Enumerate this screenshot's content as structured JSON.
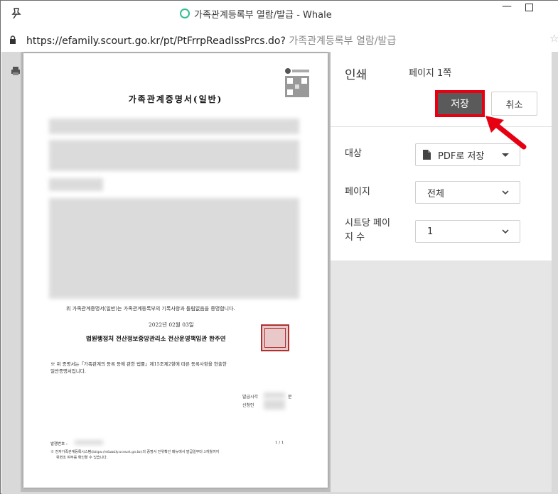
{
  "window": {
    "title": "가족관계등록부 열람/발급 - Whale",
    "minimize_glyph": "—"
  },
  "address": {
    "url": "https://efamily.scourt.go.kr/pt/PtFrrpReadIssPrcs.do?",
    "page_name": "가족관계등록부 열람/발급"
  },
  "document": {
    "title": "가족관계증명서(일반)",
    "certify_text": "위 가족관계증명서(일반)는 가족관계등록부의 기록사항과 틀림없음을 증명합니다.",
    "date": "2022년 02월 03일",
    "issuer": "법원행정처 전산정보중앙관리소 전산운영책임관 한주연",
    "note_line1": "※ 위 증명서는「가족관계의 등록 등에 관한 법률」제15조제2항에 따른 등록사항을 현출한",
    "note_line2": "일반증명서입니다.",
    "issue_time_label": "발급시각",
    "issue_time_suffix": "분",
    "applicant_label": "신청인",
    "issue_no_label": "발행번호 :",
    "page_indicator": "1 / 1",
    "footer_line1": "※ 전자가족관계등록시스템(https://efamily.scourt.go.kr)의 증명서 진위확인 메뉴에서 발급일부터 3개월까지",
    "footer_line2": "위변조 여부를 확인할 수 있습니다."
  },
  "print_panel": {
    "title": "인쇄",
    "page_count": "페이지 1쪽",
    "save_label": "저장",
    "cancel_label": "취소",
    "destination_label": "대상",
    "destination_value": "PDF로 저장",
    "pages_label": "페이지",
    "pages_value": "전체",
    "pages_per_sheet_label_1": "시트당 페이",
    "pages_per_sheet_label_2": "지 수",
    "pages_per_sheet_value": "1"
  },
  "colors": {
    "highlight": "#e60012",
    "save_button": "#5a5a5a",
    "whale_logo": "#2fbf8f"
  }
}
